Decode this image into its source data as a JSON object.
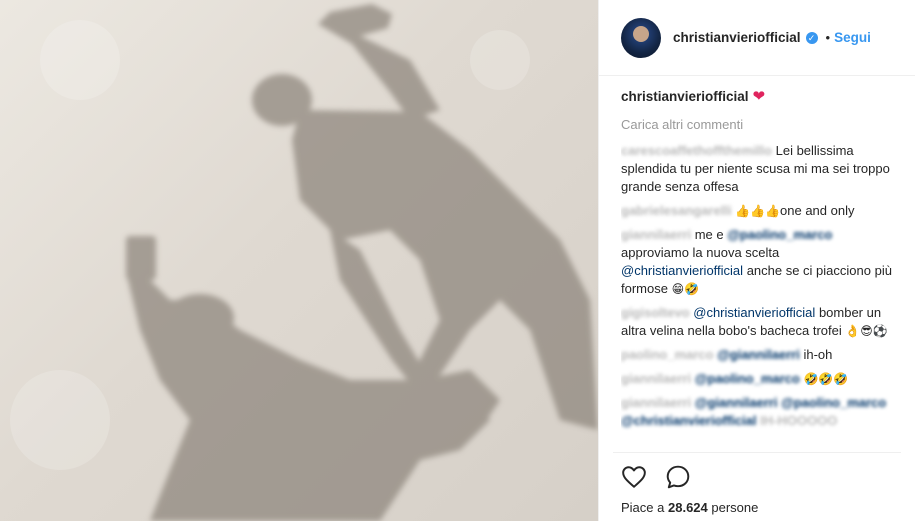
{
  "header": {
    "username": "christianvieriofficial",
    "verified_symbol": "✓",
    "separator": "•",
    "follow_label": "Segui"
  },
  "caption": {
    "username": "christianvieriofficial",
    "emoji": "❤"
  },
  "load_more": "Carica altri commenti",
  "comments": [
    {
      "user": "carescoaffethoffthemillo",
      "text": "Lei bellissima splendida tu per niente scusa mi ma sei troppo grande senza offesa"
    },
    {
      "user": "gabrielesangarelli",
      "emoji": "👍👍👍",
      "text": "one and only"
    },
    {
      "user": "giannilaerri",
      "pre": "me e",
      "mention1": "@paolino_marco",
      "text": "approviamo la nuova scelta",
      "mention2": "@christianvieriofficial",
      "text2": "anche se ci piacciono più formose",
      "emoji": "😁🤣"
    },
    {
      "user": "gigisoltevo",
      "mention": "@christianvieriofficial",
      "text": "bomber un altra velina nella bobo's bacheca trofei",
      "emoji": "👌😎⚽"
    },
    {
      "user": "paolino_marco",
      "mention": "@giannilaerri",
      "text": "ih-oh"
    },
    {
      "user": "giannilaerri",
      "mention": "@paolino_marco",
      "emoji": "🤣🤣🤣"
    },
    {
      "user": "giannilaerri",
      "mention": "@giannilaerri @paolino_marco",
      "mention2": "@christianvieriofficial",
      "text": "IH-HOOOOO"
    }
  ],
  "likes": {
    "prefix": "Piace a",
    "count": "28.624",
    "suffix": "persone"
  },
  "icons": {
    "like": "heart-outline-icon",
    "comment": "speech-bubble-icon"
  },
  "colors": {
    "accent": "#3897f0",
    "heart": "#e0245e",
    "mention": "#003569"
  }
}
